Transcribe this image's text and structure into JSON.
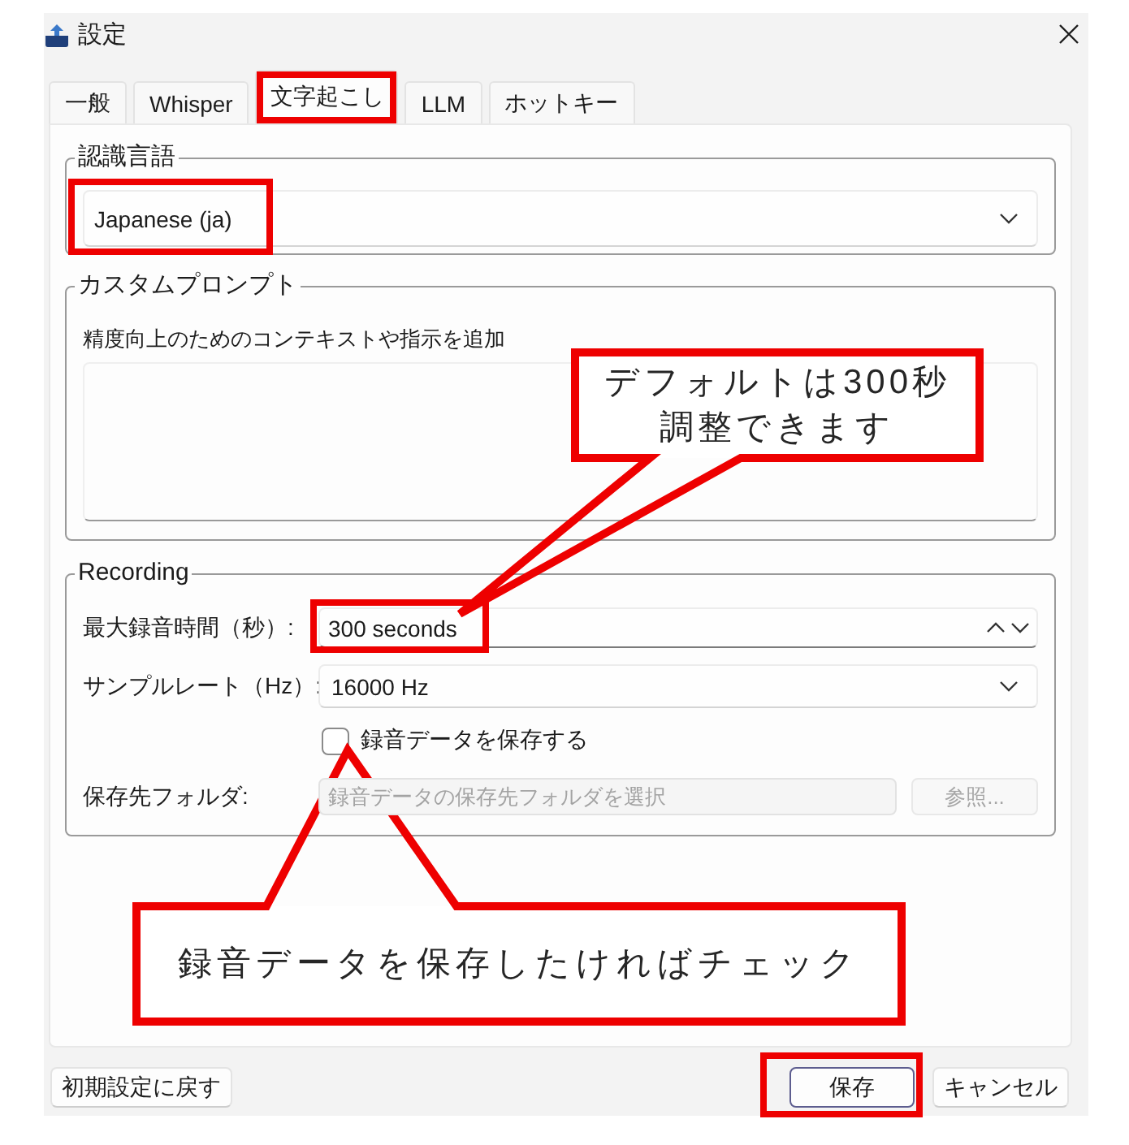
{
  "window": {
    "title": "設定"
  },
  "tabs": [
    {
      "label": "一般",
      "selected": false,
      "highlighted": false
    },
    {
      "label": "Whisper",
      "selected": false,
      "highlighted": false
    },
    {
      "label": "文字起こし",
      "selected": true,
      "highlighted": true
    },
    {
      "label": "LLM",
      "selected": false,
      "highlighted": false
    },
    {
      "label": "ホットキー",
      "selected": false,
      "highlighted": false
    }
  ],
  "language_group": {
    "legend": "認識言語",
    "select": {
      "value": "Japanese (ja)",
      "highlighted": true
    }
  },
  "prompt_group": {
    "legend": "カスタムプロンプト",
    "description": "精度向上のためのコンテキストや指示を追加"
  },
  "recording_group": {
    "legend": "Recording",
    "fields": [
      {
        "kind": "spin",
        "label": "最大録音時間（秒）:",
        "value": "300 seconds",
        "highlighted": true
      },
      {
        "kind": "select",
        "label": "サンプルレート（Hz）:",
        "value": "16000 Hz",
        "highlighted": false
      },
      {
        "kind": "checkbox",
        "label": "録音データを保存する",
        "checked": false
      },
      {
        "kind": "folder",
        "label": "保存先フォルダ:",
        "placeholder": "録音データの保存先フォルダを選択",
        "disabled": true,
        "button": {
          "label": "参照...",
          "disabled": true
        }
      }
    ]
  },
  "footer": {
    "reset_button": {
      "label": "初期設定に戻す"
    },
    "buttons": [
      {
        "label": "保存",
        "default": true,
        "highlighted": true
      },
      {
        "label": "キャンセル",
        "default": false,
        "highlighted": false
      }
    ]
  },
  "callouts": [
    {
      "lines": [
        "デフォルトは300秒",
        "調整できます"
      ]
    },
    {
      "lines": [
        "録音データを保存したければチェック"
      ]
    }
  ]
}
